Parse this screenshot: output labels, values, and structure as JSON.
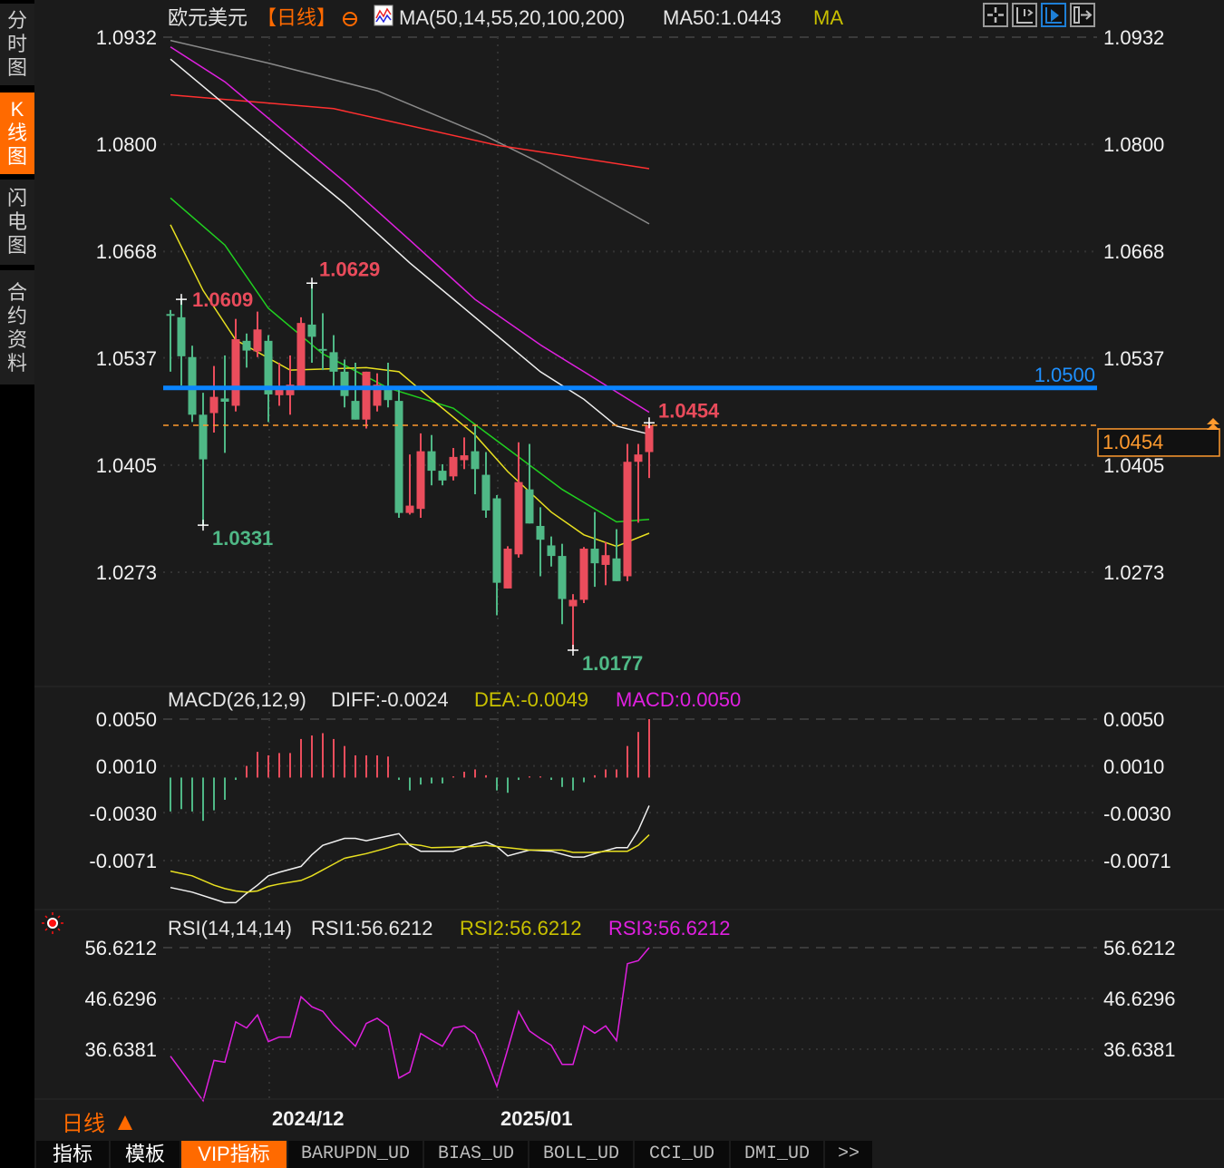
{
  "sidebar": {
    "items": [
      {
        "label": "分时图",
        "active": false
      },
      {
        "label": "K线图",
        "active": true
      },
      {
        "label": "闪电图",
        "active": false
      },
      {
        "label": "合约资料",
        "active": false
      }
    ]
  },
  "header": {
    "symbol": "欧元美元",
    "period": "【日线】",
    "ma_params": "MA(50,14,55,20,100,200)",
    "ma_value": "MA50:1.0443",
    "ma_toggle": "MA",
    "toolbar_icons": [
      "crosshair-icon",
      "axis-scale-icon",
      "axis-play-icon",
      "move-right-icon"
    ]
  },
  "colors": {
    "up": "#ea4d5c",
    "down": "#4fb886",
    "background": "#1b1b1b",
    "accent": "#ff6a00",
    "level_line": "#0a84ff"
  },
  "chart_data": [
    {
      "type": "candlestick",
      "y_ticks": [
        "1.0932",
        "1.0800",
        "1.0668",
        "1.0537",
        "1.0405",
        "1.0273"
      ],
      "x_ticks": [
        "2024/12",
        "2025/01"
      ],
      "period_label": "日线",
      "candles_ohlc": [
        [
          1.0591,
          1.0596,
          1.052,
          1.0589
        ],
        [
          1.0587,
          1.0609,
          1.0503,
          1.0539
        ],
        [
          1.0538,
          1.0552,
          1.0458,
          1.0467
        ],
        [
          1.0467,
          1.0494,
          1.0331,
          1.0412
        ],
        [
          1.0469,
          1.0527,
          1.0445,
          1.0489
        ],
        [
          1.0487,
          1.054,
          1.042,
          1.0483
        ],
        [
          1.0478,
          1.0585,
          1.0471,
          1.056
        ],
        [
          1.0558,
          1.0567,
          1.0525,
          1.0546
        ],
        [
          1.0545,
          1.0594,
          1.0538,
          1.0572
        ],
        [
          1.0558,
          1.0565,
          1.0458,
          1.0492
        ],
        [
          1.0491,
          1.0531,
          1.0478,
          1.0502
        ],
        [
          1.0491,
          1.054,
          1.0467,
          1.0504
        ],
        [
          1.0502,
          1.0587,
          1.0502,
          1.058
        ],
        [
          1.0578,
          1.0629,
          1.0531,
          1.0563
        ],
        [
          1.0548,
          1.0592,
          1.0522,
          1.0546
        ],
        [
          1.0544,
          1.0565,
          1.0498,
          1.052
        ],
        [
          1.052,
          1.0535,
          1.0476,
          1.049
        ],
        [
          1.0484,
          1.0531,
          1.0461,
          1.0461
        ],
        [
          1.0461,
          1.052,
          1.045,
          1.052
        ],
        [
          1.0478,
          1.0518,
          1.0471,
          1.0504
        ],
        [
          1.0502,
          1.0531,
          1.0476,
          1.0485
        ],
        [
          1.0484,
          1.05,
          1.034,
          1.0346
        ],
        [
          1.0346,
          1.0418,
          1.0344,
          1.0355
        ],
        [
          1.0351,
          1.0444,
          1.034,
          1.0422
        ],
        [
          1.0422,
          1.0442,
          1.038,
          1.0398
        ],
        [
          1.0398,
          1.0406,
          1.038,
          1.0386
        ],
        [
          1.0391,
          1.0426,
          1.0386,
          1.0415
        ],
        [
          1.0411,
          1.0439,
          1.04,
          1.0417
        ],
        [
          1.0422,
          1.0455,
          1.0369,
          1.04
        ],
        [
          1.0393,
          1.0421,
          1.034,
          1.0349
        ],
        [
          1.0364,
          1.0368,
          1.022,
          1.026
        ],
        [
          1.0253,
          1.0305,
          1.0253,
          1.0302
        ],
        [
          1.0295,
          1.0433,
          1.0291,
          1.0384
        ],
        [
          1.0375,
          1.0431,
          1.0333,
          1.0333
        ],
        [
          1.033,
          1.0353,
          1.0268,
          1.0313
        ],
        [
          1.0306,
          1.0317,
          1.028,
          1.0293
        ],
        [
          1.0293,
          1.0308,
          1.0209,
          1.024
        ],
        [
          1.0231,
          1.0246,
          1.0177,
          1.0239
        ],
        [
          1.0239,
          1.0304,
          1.0235,
          1.0302
        ],
        [
          1.0302,
          1.0347,
          1.0255,
          1.0284
        ],
        [
          1.0282,
          1.031,
          1.0257,
          1.0294
        ],
        [
          1.029,
          1.0326,
          1.0262,
          1.0262
        ],
        [
          1.0268,
          1.0431,
          1.0262,
          1.0409
        ],
        [
          1.0409,
          1.0431,
          1.0334,
          1.0418
        ],
        [
          1.0421,
          1.0457,
          1.0389,
          1.0454
        ]
      ],
      "ma_lines": [
        {
          "color": "#8a8a8a",
          "points": [
            [
              0,
              1.0928
            ],
            [
              9,
              1.09
            ],
            [
              19,
              1.0866
            ],
            [
              29,
              1.081
            ],
            [
              34,
              1.0777
            ],
            [
              44,
              1.0702
            ]
          ]
        },
        {
          "color": "#ff3030",
          "points": [
            [
              0,
              1.0861
            ],
            [
              15,
              1.0844
            ],
            [
              30,
              1.0799
            ],
            [
              44,
              1.077
            ]
          ]
        },
        {
          "color": "#e020e0",
          "points": [
            [
              0,
              1.092
            ],
            [
              5,
              1.0877
            ],
            [
              10,
              1.0821
            ],
            [
              16,
              1.0754
            ],
            [
              22,
              1.0682
            ],
            [
              28,
              1.0609
            ],
            [
              34,
              1.0553
            ],
            [
              38,
              1.052
            ],
            [
              44,
              1.047
            ]
          ]
        },
        {
          "color": "#f0f0f0",
          "points": [
            [
              0,
              1.0905
            ],
            [
              5,
              1.0849
            ],
            [
              10,
              1.0793
            ],
            [
              16,
              1.0727
            ],
            [
              22,
              1.0654
            ],
            [
              28,
              1.0587
            ],
            [
              34,
              1.052
            ],
            [
              38,
              1.0486
            ],
            [
              41,
              1.0453
            ],
            [
              44,
              1.0443
            ]
          ]
        },
        {
          "color": "#20d020",
          "points": [
            [
              0,
              1.0734
            ],
            [
              5,
              1.0676
            ],
            [
              9,
              1.0598
            ],
            [
              14,
              1.0542
            ],
            [
              20,
              1.05
            ],
            [
              26,
              1.0475
            ],
            [
              31,
              1.0425
            ],
            [
              36,
              1.0375
            ],
            [
              41,
              1.0335
            ],
            [
              44,
              1.0338
            ]
          ]
        },
        {
          "color": "#e8e020",
          "points": [
            [
              0,
              1.0701
            ],
            [
              3,
              1.062
            ],
            [
              6,
              1.0559
            ],
            [
              11,
              1.0522
            ],
            [
              18,
              1.0525
            ],
            [
              21,
              1.052
            ],
            [
              24,
              1.0486
            ],
            [
              28,
              1.0442
            ],
            [
              31,
              1.0397
            ],
            [
              35,
              1.0347
            ],
            [
              38,
              1.0319
            ],
            [
              41,
              1.0305
            ],
            [
              44,
              1.0321
            ]
          ]
        }
      ],
      "level_line": {
        "value": 1.05,
        "label": "1.0500"
      },
      "last_price": {
        "value": 1.0454,
        "label": "1.0454"
      },
      "annotations": [
        {
          "text": "1.0609",
          "bar": 1,
          "kind": "high"
        },
        {
          "text": "1.0629",
          "bar": 13,
          "kind": "high"
        },
        {
          "text": "1.0331",
          "bar": 3,
          "kind": "low"
        },
        {
          "text": "1.0177",
          "bar": 37,
          "kind": "low"
        },
        {
          "text": "1.0454",
          "bar": 44,
          "kind": "high"
        }
      ]
    },
    {
      "type": "bar+line",
      "title": "MACD(26,12,9)",
      "legend": {
        "diff": "DIFF:-0.0024",
        "dea": "DEA:-0.0049",
        "macd": "MACD:0.0050"
      },
      "y_ticks": [
        "0.0050",
        "0.0010",
        "-0.0030",
        "-0.0071"
      ],
      "histogram": [
        -0.0029,
        -0.0027,
        -0.0029,
        -0.0037,
        -0.0028,
        -0.0019,
        -0.0002,
        0.001,
        0.0022,
        0.0019,
        0.0021,
        0.0021,
        0.0033,
        0.0036,
        0.0038,
        0.0033,
        0.0027,
        0.0019,
        0.0019,
        0.0019,
        0.0018,
        -0.0002,
        -0.0011,
        -0.0006,
        -0.0005,
        -0.0005,
        0.0001,
        0.0005,
        0.0007,
        0.0002,
        -0.0011,
        -0.0013,
        -0.0002,
        0.0001,
        0.0001,
        -0.0002,
        -0.0008,
        -0.0011,
        -0.0004,
        0.0002,
        0.0007,
        0.0007,
        0.0027,
        0.0039,
        0.005
      ],
      "diff": [
        [
          0,
          -0.0094
        ],
        [
          2,
          -0.0098
        ],
        [
          4,
          -0.0104
        ],
        [
          5,
          -0.0107
        ],
        [
          6,
          -0.0107
        ],
        [
          7,
          -0.0099
        ],
        [
          8,
          -0.0092
        ],
        [
          9,
          -0.0084
        ],
        [
          10,
          -0.0081
        ],
        [
          12,
          -0.0076
        ],
        [
          13,
          -0.0066
        ],
        [
          14,
          -0.0058
        ],
        [
          16,
          -0.0052
        ],
        [
          17,
          -0.0052
        ],
        [
          18,
          -0.0054
        ],
        [
          20,
          -0.005
        ],
        [
          21,
          -0.0048
        ],
        [
          22,
          -0.0058
        ],
        [
          23,
          -0.0063
        ],
        [
          26,
          -0.0063
        ],
        [
          28,
          -0.0057
        ],
        [
          29,
          -0.0055
        ],
        [
          30,
          -0.0059
        ],
        [
          31,
          -0.0067
        ],
        [
          33,
          -0.0062
        ],
        [
          35,
          -0.0063
        ],
        [
          37,
          -0.0068
        ],
        [
          38,
          -0.0068
        ],
        [
          39,
          -0.0065
        ],
        [
          41,
          -0.006
        ],
        [
          42,
          -0.006
        ],
        [
          43,
          -0.0045
        ],
        [
          44,
          -0.0024
        ]
      ],
      "dea": [
        [
          0,
          -0.008
        ],
        [
          2,
          -0.0084
        ],
        [
          4,
          -0.0092
        ],
        [
          5,
          -0.0095
        ],
        [
          6,
          -0.0097
        ],
        [
          7,
          -0.0098
        ],
        [
          8,
          -0.0097
        ],
        [
          9,
          -0.0093
        ],
        [
          10,
          -0.0091
        ],
        [
          12,
          -0.0088
        ],
        [
          13,
          -0.0084
        ],
        [
          14,
          -0.0079
        ],
        [
          15,
          -0.0074
        ],
        [
          16,
          -0.0069
        ],
        [
          18,
          -0.0065
        ],
        [
          20,
          -0.006
        ],
        [
          21,
          -0.0057
        ],
        [
          22,
          -0.0057
        ],
        [
          23,
          -0.0058
        ],
        [
          24,
          -0.006
        ],
        [
          28,
          -0.0059
        ],
        [
          29,
          -0.0058
        ],
        [
          31,
          -0.006
        ],
        [
          33,
          -0.0062
        ],
        [
          36,
          -0.0062
        ],
        [
          37,
          -0.0064
        ],
        [
          39,
          -0.0064
        ],
        [
          40,
          -0.0063
        ],
        [
          42,
          -0.0063
        ],
        [
          43,
          -0.0058
        ],
        [
          44,
          -0.0049
        ]
      ],
      "colors": {
        "diff": "#f0f0f0",
        "dea": "#e8e020",
        "macd": "#e020e0"
      }
    },
    {
      "type": "line",
      "title": "RSI(14,14,14)",
      "legend": {
        "rsi1": "RSI1:56.6212",
        "rsi2": "RSI2:56.6212",
        "rsi3": "RSI3:56.6212"
      },
      "y_ticks": [
        "56.6212",
        "46.6296",
        "36.6381"
      ],
      "rsi": [
        [
          0,
          35.27
        ],
        [
          3,
          26.5
        ],
        [
          4,
          34.43
        ],
        [
          5,
          34.07
        ],
        [
          6,
          42.01
        ],
        [
          7,
          40.81
        ],
        [
          8,
          43.38
        ],
        [
          9,
          38.13
        ],
        [
          10,
          39.02
        ],
        [
          11,
          39.02
        ],
        [
          12,
          46.96
        ],
        [
          13,
          44.99
        ],
        [
          14,
          44.09
        ],
        [
          15,
          41.41
        ],
        [
          17,
          37.23
        ],
        [
          18,
          41.71
        ],
        [
          19,
          42.72
        ],
        [
          20,
          41.11
        ],
        [
          21,
          30.97
        ],
        [
          22,
          32.16
        ],
        [
          23,
          39.74
        ],
        [
          24,
          38.43
        ],
        [
          25,
          37.23
        ],
        [
          26,
          40.81
        ],
        [
          27,
          41.23
        ],
        [
          28,
          39.62
        ],
        [
          29,
          34.85
        ],
        [
          30,
          29.3
        ],
        [
          31,
          36.64
        ],
        [
          32,
          44.09
        ],
        [
          33,
          40.22
        ],
        [
          34,
          38.72
        ],
        [
          35,
          37.41
        ],
        [
          36,
          33.65
        ],
        [
          37,
          33.65
        ],
        [
          38,
          41.23
        ],
        [
          39,
          39.8
        ],
        [
          40,
          41.23
        ],
        [
          41,
          38.31
        ],
        [
          42,
          53.46
        ],
        [
          43,
          54.06
        ],
        [
          44,
          56.62
        ]
      ],
      "color": "#e020e0"
    }
  ],
  "footer": {
    "period": "日线",
    "tabs": [
      "指标",
      "模板",
      "VIP指标",
      "BARUPDN_UD",
      "BIAS_UD",
      "BOLL_UD",
      "CCI_UD",
      "DMI_UD",
      ">>"
    ],
    "active_tab": "VIP指标"
  }
}
